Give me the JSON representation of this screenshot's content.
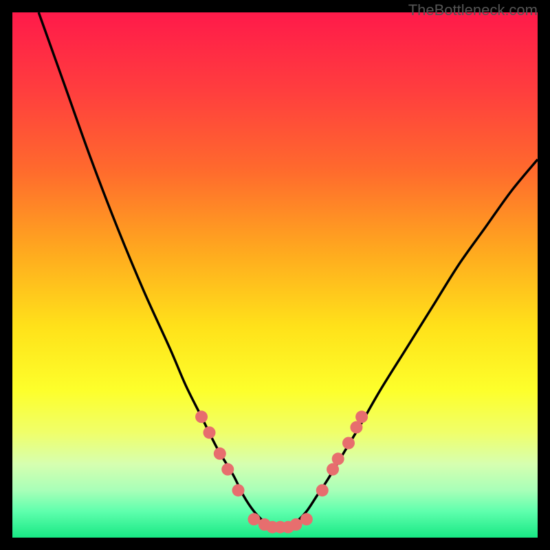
{
  "watermark": "TheBottleneck.com",
  "chart_data": {
    "type": "line",
    "title": "",
    "xlabel": "",
    "ylabel": "",
    "xlim": [
      0,
      100
    ],
    "ylim": [
      0,
      100
    ],
    "series": [
      {
        "name": "curve",
        "x": [
          5,
          10,
          15,
          20,
          25,
          30,
          33,
          36,
          39,
          42,
          44,
          46,
          48,
          50,
          52,
          54,
          56,
          58,
          60,
          63,
          66,
          70,
          75,
          80,
          85,
          90,
          95,
          100
        ],
        "y": [
          100,
          86,
          72,
          59,
          47,
          36,
          29,
          23,
          17,
          12,
          8,
          5,
          3,
          2,
          2,
          3,
          5,
          8,
          11,
          16,
          21,
          28,
          36,
          44,
          52,
          59,
          66,
          72
        ]
      }
    ],
    "markers": {
      "left_cluster": [
        {
          "x": 36,
          "y": 23
        },
        {
          "x": 37.5,
          "y": 20
        },
        {
          "x": 39.5,
          "y": 16
        },
        {
          "x": 41,
          "y": 13
        },
        {
          "x": 43,
          "y": 9
        }
      ],
      "bottom_cluster": [
        {
          "x": 46,
          "y": 3.5
        },
        {
          "x": 48,
          "y": 2.5
        },
        {
          "x": 49.5,
          "y": 2
        },
        {
          "x": 51,
          "y": 2
        },
        {
          "x": 52.5,
          "y": 2
        },
        {
          "x": 54,
          "y": 2.5
        },
        {
          "x": 56,
          "y": 3.5
        }
      ],
      "right_cluster": [
        {
          "x": 59,
          "y": 9
        },
        {
          "x": 61,
          "y": 13
        },
        {
          "x": 62,
          "y": 15
        },
        {
          "x": 64,
          "y": 18
        },
        {
          "x": 65.5,
          "y": 21
        },
        {
          "x": 66.5,
          "y": 23
        }
      ]
    },
    "gradient_stops": [
      {
        "offset": 0.0,
        "color": "#ff1a4a"
      },
      {
        "offset": 0.15,
        "color": "#ff3e3e"
      },
      {
        "offset": 0.3,
        "color": "#ff6a2d"
      },
      {
        "offset": 0.45,
        "color": "#ffa71f"
      },
      {
        "offset": 0.6,
        "color": "#ffe21a"
      },
      {
        "offset": 0.72,
        "color": "#fdff2b"
      },
      {
        "offset": 0.8,
        "color": "#f0ff6a"
      },
      {
        "offset": 0.86,
        "color": "#d6ffb0"
      },
      {
        "offset": 0.91,
        "color": "#a8ffb8"
      },
      {
        "offset": 0.95,
        "color": "#5fffad"
      },
      {
        "offset": 1.0,
        "color": "#18e884"
      }
    ],
    "marker_color": "#e76e6e",
    "curve_color": "#000000"
  }
}
